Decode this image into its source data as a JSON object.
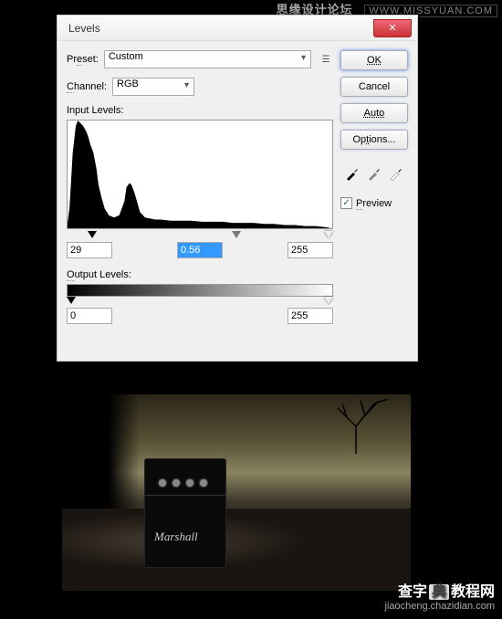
{
  "watermark_top": {
    "chinese": "思缘设计论坛",
    "url": "WWW.MISSYUAN.COM"
  },
  "dialog": {
    "title": "Levels",
    "preset_label": "Preset:",
    "preset_value": "Custom",
    "channel_label": "Channel:",
    "channel_value": "RGB",
    "input_levels_label": "Input Levels:",
    "input_black": "29",
    "input_gamma": "0.56",
    "input_white": "255",
    "output_levels_label": "Output Levels:",
    "output_black": "0",
    "output_white": "255"
  },
  "buttons": {
    "ok": "OK",
    "cancel": "Cancel",
    "auto": "Auto",
    "options": "Options..."
  },
  "preview": {
    "label": "Preview",
    "checked": "✓"
  },
  "amp_brand": "Marshall",
  "watermark_bottom": {
    "main_a": "查字",
    "main_b": "典",
    "main_tail": "教程网",
    "sub": "jiaocheng.chazidian.com"
  },
  "chart_data": {
    "type": "histogram",
    "title": "Input Levels",
    "xlabel": "",
    "ylabel": "",
    "xlim": [
      0,
      255
    ],
    "ylim": [
      0,
      100
    ],
    "note": "Image tonal histogram; y is relative pixel count",
    "series": [
      {
        "name": "RGB",
        "x": [
          0,
          2,
          5,
          8,
          10,
          12,
          15,
          18,
          20,
          22,
          25,
          28,
          30,
          33,
          36,
          40,
          45,
          50,
          55,
          57,
          60,
          62,
          65,
          68,
          70,
          75,
          80,
          85,
          90,
          100,
          110,
          120,
          130,
          140,
          150,
          160,
          170,
          180,
          190,
          200,
          210,
          220,
          230,
          240,
          250,
          255
        ],
        "values": [
          5,
          20,
          70,
          95,
          100,
          98,
          95,
          90,
          85,
          78,
          70,
          55,
          40,
          28,
          18,
          12,
          10,
          12,
          25,
          38,
          42,
          40,
          32,
          22,
          15,
          10,
          9,
          8,
          8,
          7,
          7,
          7,
          6,
          6,
          6,
          5,
          5,
          5,
          4,
          4,
          3,
          3,
          2,
          2,
          1,
          0
        ]
      }
    ],
    "input_markers": {
      "black": 29,
      "gamma": 0.56,
      "white": 255
    },
    "output_markers": {
      "black": 0,
      "white": 255
    }
  }
}
